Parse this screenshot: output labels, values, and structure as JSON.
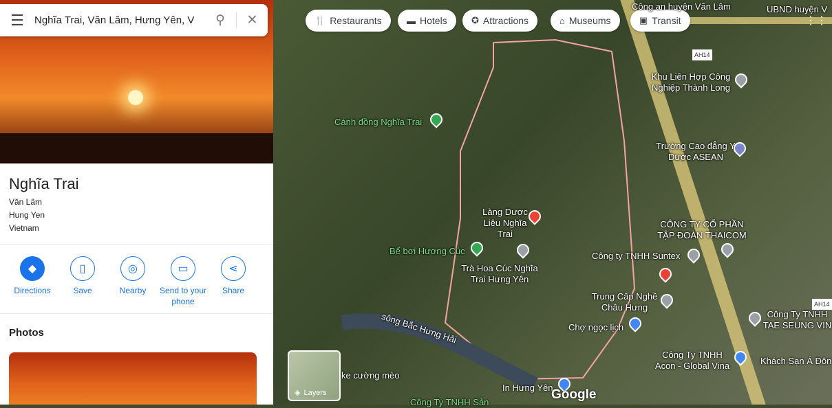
{
  "search": {
    "query": "Nghĩa Trai, Văn Lâm, Hưng Yên, V"
  },
  "place": {
    "title": "Nghĩa Trai",
    "address": [
      "Văn Lâm",
      "Hung Yen",
      "Vietnam"
    ]
  },
  "actions": [
    {
      "label": "Directions"
    },
    {
      "label": "Save"
    },
    {
      "label": "Nearby"
    },
    {
      "label": "Send to your phone"
    },
    {
      "label": "Share"
    }
  ],
  "photos_heading": "Photos",
  "chips": [
    "Restaurants",
    "Hotels",
    "Attractions",
    "Museums",
    "Transit"
  ],
  "labels": {
    "l1": "Công an huyện Văn Lâm",
    "l2": "UBND huyện V",
    "l3": "Khu Liên Hợp Công Nghiệp Thành Long",
    "l4": "Cánh đồng Nghĩa Trai",
    "l5": "Trường Cao đẳng Y Dược ASEAN",
    "l6": "Làng Dược Liệu Nghĩa Trai",
    "l7": "Bể bơi Hương Cúc",
    "l8": "CÔNG TY CỔ PHẦN TẬP ĐOÀN THAICOM",
    "l9": "Công ty TNHH Suntex",
    "l10": "Trà Hoa Cúc Nghĩa Trai Hưng Yên",
    "l11": "Trung Cấp Nghề Châu Hưng",
    "l12": "Chợ ngọc lịch",
    "l13": "sông Bắc Hưng Hải",
    "l14": "Công Ty TNHH TAE SEUNG VIN",
    "l15": "Công Ty TNHH Acon - Global Vina",
    "l16": "Khách Sạn Á Đôn",
    "l17": "In Hưng Yên",
    "l18": "ke cường mèo",
    "l19": "Công Ty TNHH Sản",
    "l20": "AH14",
    "l21": "AH14"
  },
  "layers_label": "Layers",
  "brand": "Google"
}
